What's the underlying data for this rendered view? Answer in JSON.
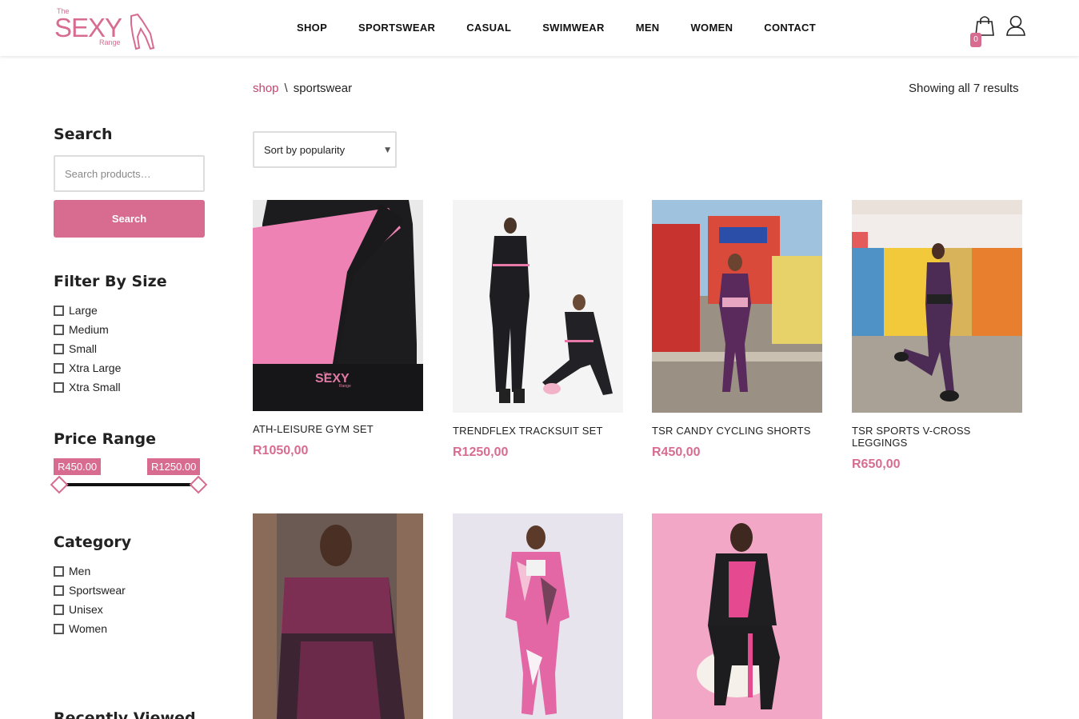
{
  "brand": {
    "logo_small_top": "The",
    "logo_main": "SEXY",
    "logo_small_bottom": "Range",
    "accent_color": "#d86c90"
  },
  "nav": {
    "items": [
      "SHOP",
      "SPORTSWEAR",
      "CASUAL",
      "SWIMWEAR",
      "MEN",
      "WOMEN",
      "CONTACT"
    ]
  },
  "header_icons": {
    "cart_icon": "shopping-bag-icon",
    "cart_count": "0",
    "user_icon": "user-icon"
  },
  "breadcrumb": {
    "link": "shop",
    "separator": "\\",
    "current": "sportswear"
  },
  "results_count": "Showing all 7 results",
  "sidebar": {
    "search_heading": "Search",
    "search_placeholder": "Search products…",
    "search_button": "Search",
    "size_heading": "Filter By Size",
    "sizes": [
      "Large",
      "Medium",
      "Small",
      "Xtra Large",
      "Xtra Small"
    ],
    "price_heading": "Price Range",
    "price_min": "R450.00",
    "price_max": "R1250.00",
    "category_heading": "Category",
    "categories": [
      "Men",
      "Sportswear",
      "Unisex",
      "Women"
    ],
    "recent_heading": "Recently Viewed"
  },
  "sort": {
    "selected": "Sort by popularity"
  },
  "products": [
    {
      "name": "ATH-LEISURE GYM SET",
      "price": "R1050,00"
    },
    {
      "name": "TRENDFLEX TRACKSUIT SET",
      "price": "R1250,00"
    },
    {
      "name": "TSR CANDY CYCLING SHORTS",
      "price": "R450,00"
    },
    {
      "name": "TSR SPORTS V-CROSS LEGGINGS",
      "price": "R650,00"
    },
    {
      "name": "",
      "price": ""
    },
    {
      "name": "",
      "price": ""
    },
    {
      "name": "",
      "price": ""
    }
  ],
  "product_image_logo": {
    "top": "The",
    "main": "SEXY",
    "bottom": "Range"
  }
}
